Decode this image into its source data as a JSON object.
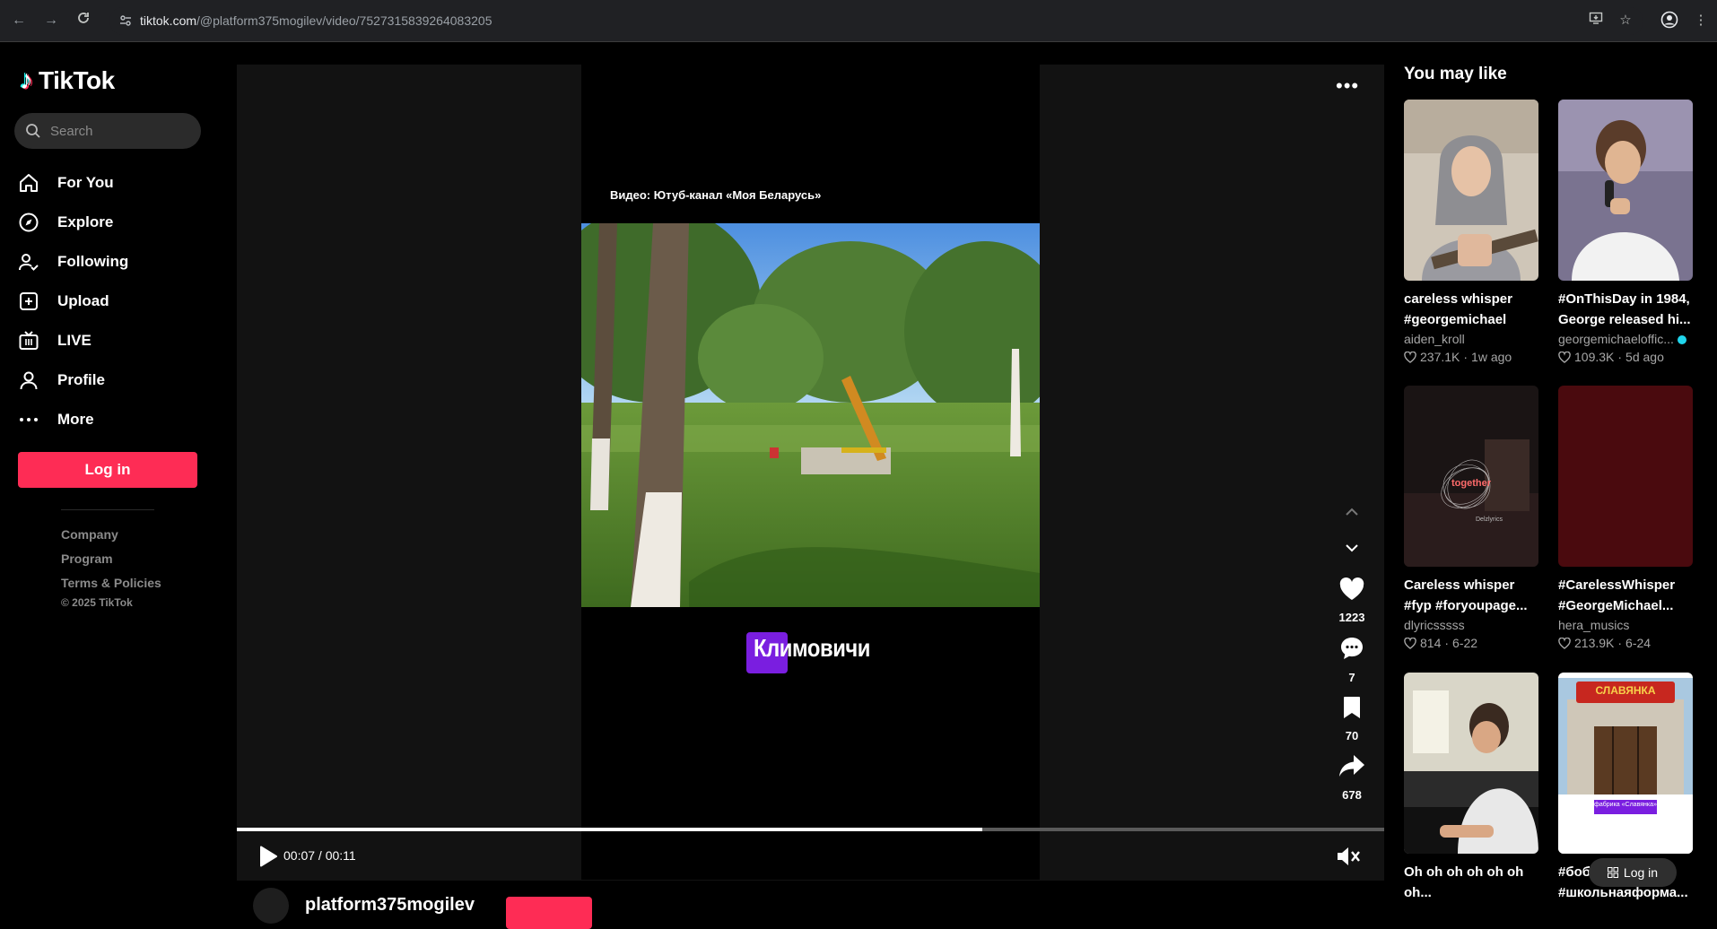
{
  "browser": {
    "url_host": "tiktok.com",
    "url_path": "/@platform375mogilev/video/7527315839264083205"
  },
  "sidebar": {
    "logo_text": "TikTok",
    "search_placeholder": "Search",
    "items": [
      {
        "label": "For You",
        "icon": "home-icon"
      },
      {
        "label": "Explore",
        "icon": "compass-icon"
      },
      {
        "label": "Following",
        "icon": "following-icon"
      },
      {
        "label": "Upload",
        "icon": "upload-icon"
      },
      {
        "label": "LIVE",
        "icon": "live-icon"
      },
      {
        "label": "Profile",
        "icon": "profile-icon"
      },
      {
        "label": "More",
        "icon": "more-icon"
      }
    ],
    "login_label": "Log in",
    "footer": [
      "Company",
      "Program",
      "Terms & Policies"
    ],
    "copyright": "© 2025 TikTok"
  },
  "video": {
    "caption_top": "Видео: Ютуб-канал «Моя Беларусь»",
    "city_tag": "Климовичи",
    "likes": "1223",
    "comments": "7",
    "saves": "70",
    "shares": "678",
    "time": "00:07 / 00:11",
    "progress": 0.65,
    "author": "platform375mogilev"
  },
  "recommendations": {
    "title": "You may like",
    "cards": [
      {
        "title_1": "careless whisper",
        "title_2": "#georgemichael",
        "user": "aiden_kroll",
        "likes": "237.1K",
        "date": "1w ago",
        "verified": false
      },
      {
        "title_1": "#OnThisDay in 1984,",
        "title_2": "George released hi...",
        "user": "georgemichaeloffic...",
        "likes": "109.3K",
        "date": "5d ago",
        "verified": true
      },
      {
        "title_1": "Careless whisper",
        "title_2": "#fyp #foryoupage...",
        "user": "dlyricsssss",
        "likes": "814",
        "date": "6-22",
        "verified": false,
        "thumb_text": "together",
        "thumb_sub": "Delzlyrics"
      },
      {
        "title_1": "#CarelessWhisper",
        "title_2": "#GeorgeMichael...",
        "user": "hera_musics",
        "likes": "213.9K",
        "date": "6-24",
        "verified": false
      },
      {
        "title_1": "Oh oh oh oh oh oh",
        "title_2": "oh...",
        "user": "",
        "likes": "",
        "date": "",
        "verified": false
      },
      {
        "title_1": "#боб",
        "title_2": "#школьнаяформа...",
        "user": "",
        "likes": "",
        "date": "",
        "verified": false,
        "thumb_text": "СЛАВЯНКА",
        "thumb_sub": "фабрика «Славянка»"
      }
    ],
    "float_login": "Log in"
  }
}
